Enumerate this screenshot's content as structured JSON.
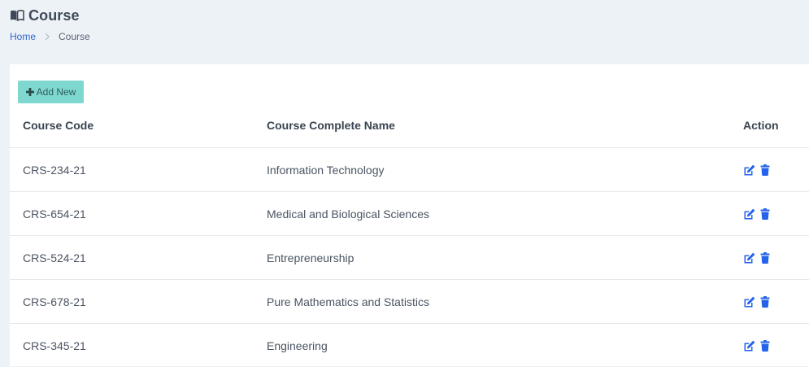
{
  "page": {
    "title": "Course",
    "title_icon": "book-open-icon"
  },
  "breadcrumb": {
    "home": "Home",
    "current": "Course"
  },
  "toolbar": {
    "add_label": "Add New",
    "add_icon": "plus-icon"
  },
  "table": {
    "headers": {
      "code": "Course Code",
      "name": "Course Complete Name",
      "action": "Action"
    },
    "rows": [
      {
        "code": "CRS-234-21",
        "name": "Information Technology"
      },
      {
        "code": "CRS-654-21",
        "name": "Medical and Biological Sciences"
      },
      {
        "code": "CRS-524-21",
        "name": "Entrepreneurship"
      },
      {
        "code": "CRS-678-21",
        "name": "Pure Mathematics and Statistics"
      },
      {
        "code": "CRS-345-21",
        "name": "Engineering"
      }
    ],
    "row_action_icons": [
      "edit-icon",
      "trash-icon"
    ]
  },
  "colors": {
    "page_background": "#edf2f7",
    "card_background": "#ffffff",
    "accent_teal": "#7fd8d0",
    "link_blue": "#2f66cc",
    "action_icon_blue": "#2563eb"
  }
}
